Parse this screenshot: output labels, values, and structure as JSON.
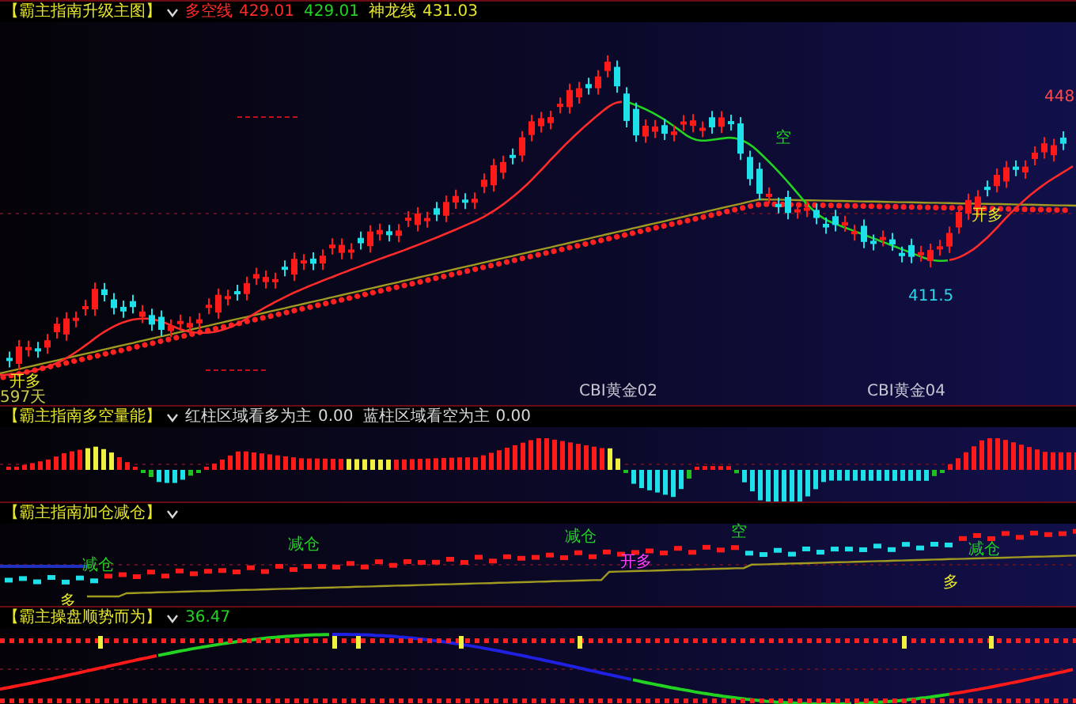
{
  "panels": [
    {
      "title": "【霸主指南升级主图】",
      "readings": [
        {
          "label": "多空线",
          "value": "429.01",
          "color": "#ff2a2a"
        },
        {
          "value": "429.01",
          "color": "#22d322"
        },
        {
          "label": "神龙线",
          "value": "431.03",
          "color": "#e6e62a"
        }
      ],
      "labels": [
        {
          "text": "开多",
          "kind": "signal"
        },
        {
          "text": "空",
          "kind": "signal_short"
        },
        {
          "text": "开多",
          "kind": "signal"
        },
        {
          "text": "411.5",
          "kind": "price_low"
        },
        {
          "text": "448",
          "kind": "price_high"
        },
        {
          "text": "597天",
          "kind": "days"
        },
        {
          "text": "CBI黄金02",
          "kind": "contract"
        },
        {
          "text": "CBI黄金04",
          "kind": "contract"
        }
      ]
    },
    {
      "title": "【霸主指南多空量能】",
      "readings": [
        {
          "label": "红柱区域看多为主",
          "value": "0.00",
          "color": "#d8d8d8"
        },
        {
          "label": "蓝柱区域看空为主",
          "value": "0.00",
          "color": "#d8d8d8"
        }
      ]
    },
    {
      "title": "【霸主指南加仓减仓】",
      "labels": [
        {
          "text": "减仓",
          "kind": "signal_short"
        },
        {
          "text": "减仓",
          "kind": "signal_short"
        },
        {
          "text": "减仓",
          "kind": "signal_short"
        },
        {
          "text": "空",
          "kind": "signal_short"
        },
        {
          "text": "减仓",
          "kind": "signal_short"
        },
        {
          "text": "多",
          "kind": "signal"
        },
        {
          "text": "多",
          "kind": "signal"
        },
        {
          "text": "开多",
          "kind": "signal_open"
        }
      ]
    },
    {
      "title": "【霸主操盘顺势而为】",
      "readings": [
        {
          "value": "36.47",
          "color": "#22d322"
        }
      ]
    }
  ]
}
